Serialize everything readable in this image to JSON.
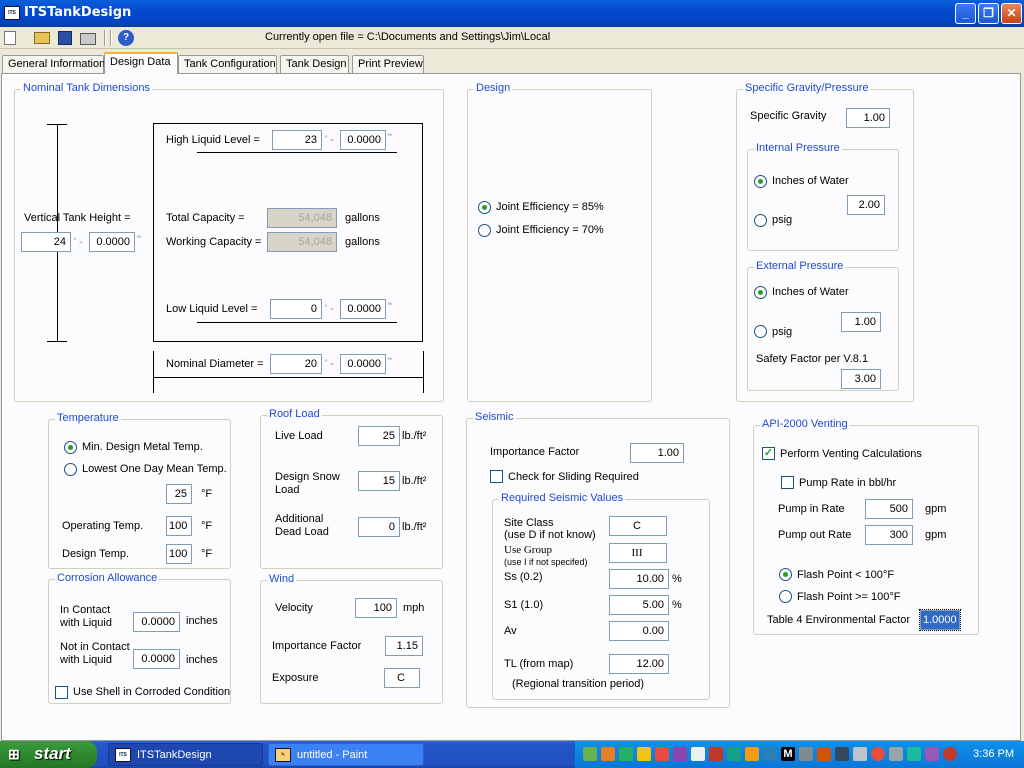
{
  "window": {
    "title": "ITSTankDesign",
    "icon": "app-icon",
    "minimize": "_",
    "maximize": "❐",
    "close": "✕"
  },
  "toolbar": {
    "current_file": "Currently open file = C:\\Documents and Settings\\Jim\\Local",
    "icons": [
      "new-file-icon",
      "open-folder-icon",
      "save-icon",
      "print-icon",
      "help-icon"
    ]
  },
  "tabs": [
    "General Information",
    "Design Data",
    "Tank Configuration",
    "Tank Design",
    "Print Preview"
  ],
  "nominal": {
    "title": "Nominal Tank Dimensions",
    "vertical_label": "Vertical Tank Height =",
    "vertical_ft": "24",
    "vertical_in": "0.0000",
    "hll_label": "High Liquid Level =",
    "hll_ft": "23",
    "hll_in": "0.0000",
    "total_label": "Total Capacity =",
    "total_val": "54,048",
    "total_unit": "gallons",
    "working_label": "Working Capacity =",
    "working_val": "54,048",
    "working_unit": "gallons",
    "lll_label": "Low Liquid Level =",
    "lll_ft": "0",
    "lll_in": "0.0000",
    "dia_label": "Nominal Diameter =",
    "dia_ft": "20",
    "dia_in": "0.0000",
    "ft_mark": "' -",
    "in_mark": "\""
  },
  "design": {
    "title": "Design",
    "opt1": "Joint Efficiency = 85%",
    "opt2": "Joint Efficiency = 70%"
  },
  "sg": {
    "title": "Specific Gravity/Pressure",
    "sg_label": "Specific Gravity",
    "sg_val": "1.00",
    "int_title": "Internal Pressure",
    "int_opt1": "Inches of Water",
    "int_opt2": "psig",
    "int_val": "2.00",
    "ext_title": "External Pressure",
    "ext_opt1": "Inches of Water",
    "ext_opt2": "psig",
    "ext_val": "1.00",
    "sf_label": "Safety Factor per V.8.1",
    "sf_val": "3.00"
  },
  "temperature": {
    "title": "Temperature",
    "opt1": "Min. Design Metal Temp.",
    "opt2": "Lowest One Day Mean Temp.",
    "temp_val": "25",
    "unit": "°F",
    "op_label": "Operating Temp.",
    "op_val": "100",
    "dt_label": "Design Temp.",
    "dt_val": "100"
  },
  "corrosion": {
    "title": "Corrosion Allowance",
    "contact_label1": "In Contact",
    "contact_label2": "with Liquid",
    "contact_val": "0.0000",
    "unit": "inches",
    "nocontact_label1": "Not in Contact",
    "nocontact_label2": "with Liquid",
    "nocontact_val": "0.0000",
    "shell_label": "Use Shell in Corroded Condition"
  },
  "roof": {
    "title": "Roof Load",
    "live_label": "Live Load",
    "live_val": "25",
    "unit": "lb./ft²",
    "snow_label1": "Design Snow",
    "snow_label2": "Load",
    "snow_val": "15",
    "dead_label1": "Additional",
    "dead_label2": "Dead Load",
    "dead_val": "0"
  },
  "wind": {
    "title": "Wind",
    "vel_label": "Velocity",
    "vel_val": "100",
    "vel_unit": "mph",
    "if_label": "Importance Factor",
    "if_val": "1.15",
    "exp_label": "Exposure",
    "exp_val": "C"
  },
  "seismic": {
    "title": "Seismic",
    "if_label": "Importance Factor",
    "if_val": "1.00",
    "sliding_label": "Check for Sliding Required",
    "req_title": "Required Seismic Values",
    "site_label1": "Site Class",
    "site_label2": "(use D if not know)",
    "site_val": "C",
    "use_label1": "Use Group",
    "use_label2": "(use I if not specifed)",
    "use_val": "III",
    "ss_label": "Ss (0.2)",
    "ss_val": "10.00",
    "s1_label": "S1 (1.0)",
    "s1_val": "5.00",
    "pct": "%",
    "av_label": "Av",
    "av_val": "0.00",
    "tl_label": "TL (from map)",
    "tl_val": "12.00",
    "tl_note": "(Regional transition period)"
  },
  "api": {
    "title": "API-2000 Venting",
    "perform_label": "Perform Venting Calculations",
    "bbl_label": "Pump Rate in bbl/hr",
    "pin_label": "Pump in Rate",
    "pin_val": "500",
    "pout_label": "Pump out Rate",
    "pout_val": "300",
    "gpm": "gpm",
    "fp1": "Flash Point < 100°F",
    "fp2": "Flash Point >= 100°F",
    "env_label": "Table 4 Environmental Factor",
    "env_val": "1.0000"
  },
  "taskbar": {
    "start": "start",
    "task1": "ITSTankDesign",
    "task2": "untitled - Paint",
    "clock": "3:36 PM"
  }
}
